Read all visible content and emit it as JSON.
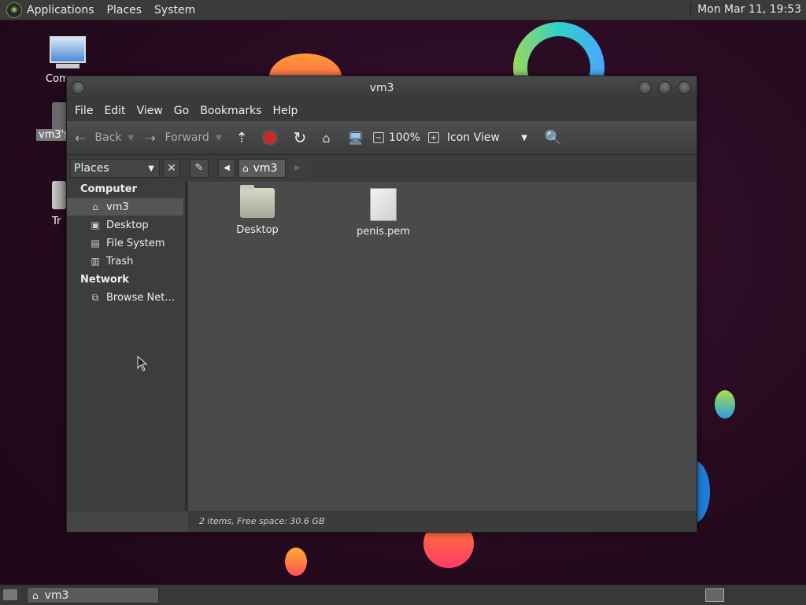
{
  "top_panel": {
    "menus": [
      "Applications",
      "Places",
      "System"
    ],
    "clock": "Mon Mar 11, 19:53"
  },
  "desktop_icons": [
    {
      "label": "Com",
      "icon": "computer-icon"
    },
    {
      "label": "vm3's",
      "icon": "home-folder-icon"
    },
    {
      "label": "Tr",
      "icon": "trash-icon"
    }
  ],
  "window": {
    "title": "vm3",
    "menu": [
      "File",
      "Edit",
      "View",
      "Go",
      "Bookmarks",
      "Help"
    ],
    "toolbar": {
      "back": "Back",
      "forward": "Forward",
      "zoom": "100%",
      "view_mode": "Icon View"
    },
    "location": {
      "places_label": "Places",
      "crumb": "vm3"
    },
    "sidebar": {
      "sections": [
        {
          "heading": "Computer",
          "items": [
            {
              "label": "vm3",
              "icon": "home-icon",
              "selected": true
            },
            {
              "label": "Desktop",
              "icon": "desktop-icon"
            },
            {
              "label": "File System",
              "icon": "drive-icon"
            },
            {
              "label": "Trash",
              "icon": "trash-icon"
            }
          ]
        },
        {
          "heading": "Network",
          "items": [
            {
              "label": "Browse Net…",
              "icon": "network-icon"
            }
          ]
        }
      ]
    },
    "files": [
      {
        "name": "Desktop",
        "icon": "folder-icon"
      },
      {
        "name": "penis.pem",
        "icon": "document-icon"
      }
    ],
    "status": "2 items, Free space: 30.6 GB"
  },
  "taskbar": {
    "task_label": "vm3"
  },
  "colors": {
    "panel": "#3b3b3b",
    "window_bg": "#4a4a4a",
    "selected": "#555555"
  }
}
